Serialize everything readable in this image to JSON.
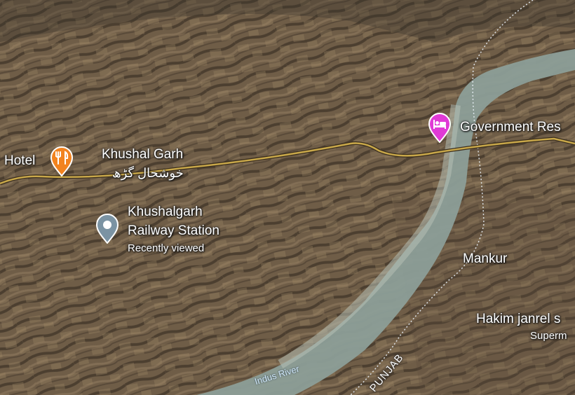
{
  "places": {
    "hotel": {
      "label": "Hotel",
      "icon": "restaurant-icon",
      "color": "#f2831f"
    },
    "town": {
      "label": "Khushal Garh",
      "label_urdu": "خوشحال گڑھ"
    },
    "station": {
      "line1": "Khushalgarh",
      "line2": "Railway Station",
      "sub": "Recently viewed",
      "icon": "location-pin-icon",
      "color": "#7b93a3"
    },
    "rest_house": {
      "label": "Government Res",
      "icon": "hotel-bed-icon",
      "color": "#e03ad6"
    },
    "mankur": {
      "label": "Mankur"
    },
    "hakim": {
      "label": "Hakim janrel s",
      "sub": "Superm"
    }
  },
  "features": {
    "river": "Indus River",
    "province": "PUNJAB"
  },
  "colors": {
    "road": "#c9a84a",
    "river": "#8c9e98",
    "terrain": "#6b5a45"
  }
}
